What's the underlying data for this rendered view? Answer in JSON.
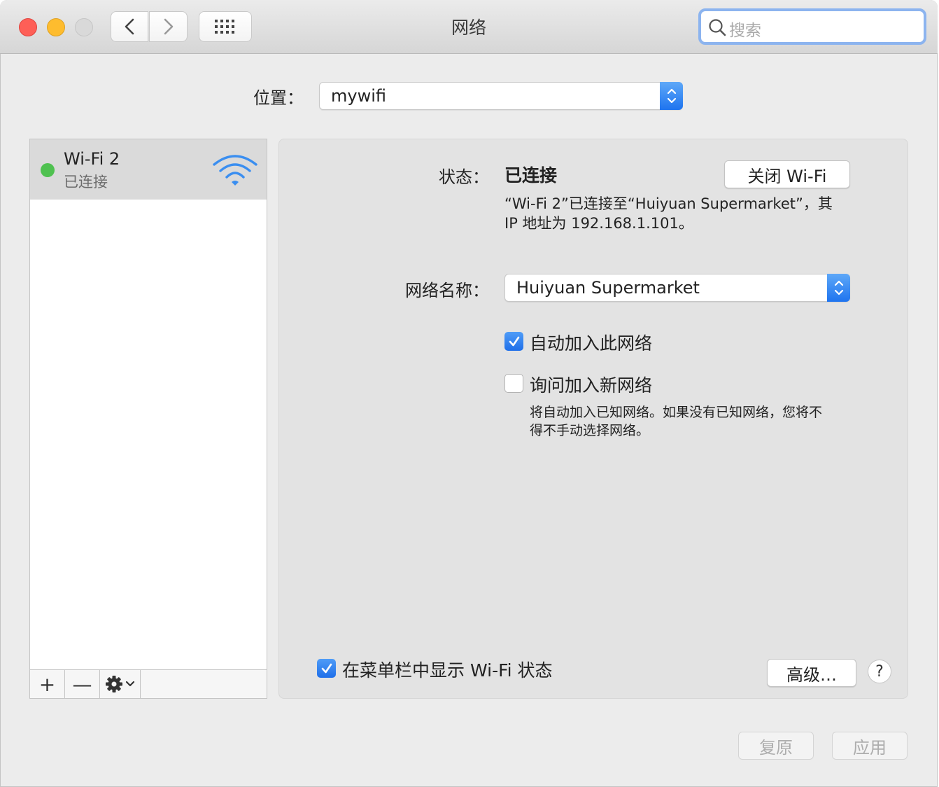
{
  "window": {
    "title": "网络",
    "search_placeholder": "搜索"
  },
  "location": {
    "label": "位置：",
    "value": "mywifi"
  },
  "sidebar": {
    "items": [
      {
        "name": "Wi-Fi 2",
        "status": "已连接",
        "status_color": "#4fc150"
      }
    ],
    "tools": {
      "add": "+",
      "remove": "—"
    }
  },
  "detail": {
    "status_label": "状态：",
    "status_value": "已连接",
    "turn_off_button": "关闭 Wi-Fi",
    "description_line1": "“Wi-Fi 2”已连接至“Huiyuan Supermarket”，其",
    "description_line2": "IP 地址为 192.168.1.101。",
    "network_name_label": "网络名称：",
    "network_name_value": "Huiyuan Supermarket",
    "auto_join": {
      "label": "自动加入此网络",
      "checked": true
    },
    "ask_join": {
      "label": "询问加入新网络",
      "checked": false
    },
    "ask_join_desc_line1": "将自动加入已知网络。如果没有已知网络，您将不",
    "ask_join_desc_line2": "得不手动选择网络。",
    "show_in_menubar": {
      "label": "在菜单栏中显示 Wi-Fi 状态",
      "checked": true
    },
    "advanced_button": "高级…",
    "help_button": "?"
  },
  "footer": {
    "revert_button": "复原",
    "apply_button": "应用"
  },
  "colors": {
    "accent": "#1f6fe9",
    "connected": "#4fc150"
  }
}
